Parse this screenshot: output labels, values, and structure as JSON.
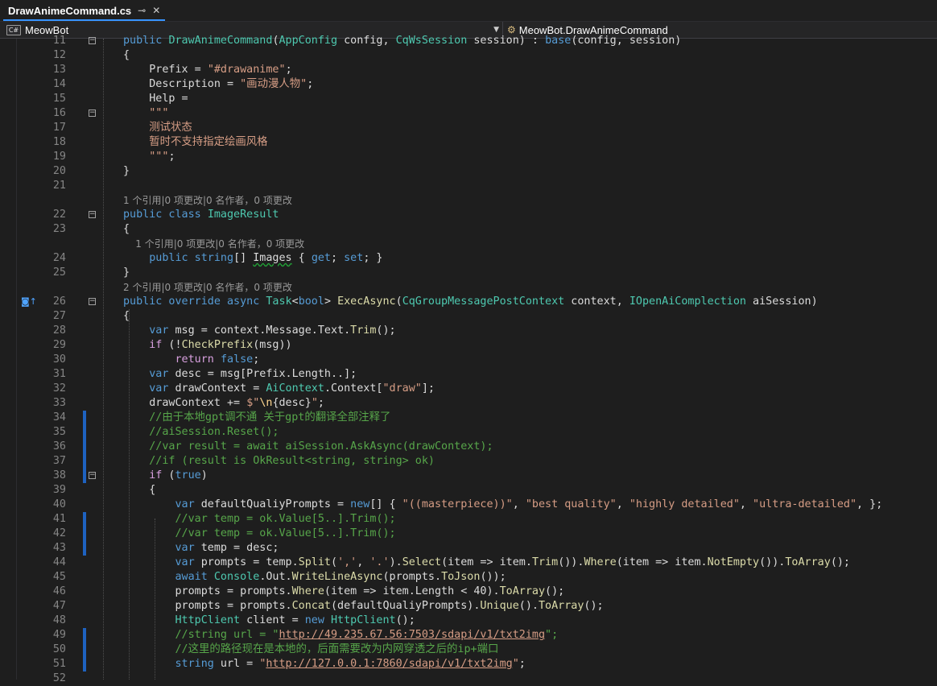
{
  "tab": {
    "title": "DrawAnimeCommand.cs",
    "pin_glyph": "⊸",
    "close_glyph": "✕"
  },
  "nav": {
    "project": "MeowBot",
    "project_icon": "C#",
    "member": "MeowBot.DrawAnimeCommand"
  },
  "editor": {
    "lines": [
      {
        "n": "11",
        "fold": "⊟",
        "toks": [
          [
            "kw",
            "public "
          ],
          [
            "ty",
            "DrawAnimeCommand"
          ],
          [
            "",
            "("
          ],
          [
            "ty",
            "AppConfig"
          ],
          [
            "",
            " config, "
          ],
          [
            "ty",
            "CqWsSession"
          ],
          [
            "",
            " session) : "
          ],
          [
            "kw",
            "base"
          ],
          [
            "",
            "(config, session)"
          ]
        ]
      },
      {
        "n": "12",
        "toks": [
          [
            "",
            "{"
          ]
        ]
      },
      {
        "n": "13",
        "toks": [
          [
            "",
            "    Prefix = "
          ],
          [
            "str",
            "\"#drawanime\""
          ],
          [
            "",
            ";"
          ]
        ]
      },
      {
        "n": "14",
        "toks": [
          [
            "",
            "    Description = "
          ],
          [
            "str",
            "\"画动漫人物\""
          ],
          [
            "",
            ";"
          ]
        ]
      },
      {
        "n": "15",
        "toks": [
          [
            "",
            "    Help ="
          ]
        ]
      },
      {
        "n": "16",
        "fold": "⊟",
        "toks": [
          [
            "str",
            "    \"\"\""
          ]
        ]
      },
      {
        "n": "17",
        "toks": [
          [
            "str",
            "    测试状态"
          ]
        ]
      },
      {
        "n": "18",
        "toks": [
          [
            "str",
            "    暂时不支持指定绘画风格"
          ]
        ]
      },
      {
        "n": "19",
        "toks": [
          [
            "str",
            "    \"\"\""
          ],
          [
            "",
            ";"
          ]
        ]
      },
      {
        "n": "20",
        "toks": [
          [
            "",
            "}"
          ]
        ]
      },
      {
        "n": "21",
        "toks": []
      },
      {
        "lens": "1 个引用|0 项更改|0 名作者，0 项更改"
      },
      {
        "n": "22",
        "fold": "⊟",
        "toks": [
          [
            "kw",
            "public class "
          ],
          [
            "ty",
            "ImageResult"
          ]
        ]
      },
      {
        "n": "23",
        "toks": [
          [
            "",
            "{"
          ]
        ]
      },
      {
        "lens": "    1 个引用|0 项更改|0 名作者，0 项更改"
      },
      {
        "n": "24",
        "toks": [
          [
            "kw",
            "    public string"
          ],
          [
            "",
            "[] "
          ],
          [
            "sq",
            "Images"
          ],
          [
            "",
            " { "
          ],
          [
            "kw",
            "get"
          ],
          [
            "",
            "; "
          ],
          [
            "kw",
            "set"
          ],
          [
            "",
            "; }"
          ]
        ]
      },
      {
        "n": "25",
        "toks": [
          [
            "",
            "}"
          ]
        ]
      },
      {
        "lens": "2 个引用|0 项更改|0 名作者，0 项更改"
      },
      {
        "n": "26",
        "fold": "⊟",
        "mark": "◙↑",
        "toks": [
          [
            "kw",
            "public override async "
          ],
          [
            "ty",
            "Task"
          ],
          [
            "",
            "<"
          ],
          [
            "kw",
            "bool"
          ],
          [
            "",
            "> "
          ],
          [
            "mth",
            "ExecAsync"
          ],
          [
            "",
            "("
          ],
          [
            "ty",
            "CqGroupMessagePostContext"
          ],
          [
            "",
            " context, "
          ],
          [
            "ty",
            "IOpenAiComplection"
          ],
          [
            "",
            " aiSession)"
          ]
        ]
      },
      {
        "n": "27",
        "toks": [
          [
            "",
            "{"
          ]
        ]
      },
      {
        "n": "28",
        "toks": [
          [
            "kw",
            "    var"
          ],
          [
            "",
            " msg = context.Message.Text."
          ],
          [
            "mth",
            "Trim"
          ],
          [
            "",
            "();"
          ]
        ]
      },
      {
        "n": "29",
        "toks": [
          [
            "ctl",
            "    if"
          ],
          [
            "",
            " (!"
          ],
          [
            "mth",
            "CheckPrefix"
          ],
          [
            "",
            "(msg))"
          ]
        ]
      },
      {
        "n": "30",
        "toks": [
          [
            "ctl",
            "        return "
          ],
          [
            "kw",
            "false"
          ],
          [
            "",
            ";"
          ]
        ]
      },
      {
        "n": "31",
        "toks": [
          [
            "kw",
            "    var"
          ],
          [
            "",
            " desc = msg[Prefix.Length..];"
          ]
        ]
      },
      {
        "n": "32",
        "toks": [
          [
            "kw",
            "    var"
          ],
          [
            "",
            " drawContext = "
          ],
          [
            "ty",
            "AiContext"
          ],
          [
            "",
            ".Context["
          ],
          [
            "str",
            "\"draw\""
          ],
          [
            "",
            "];"
          ]
        ]
      },
      {
        "n": "33",
        "toks": [
          [
            "",
            "    drawContext += "
          ],
          [
            "str",
            "$\""
          ],
          [
            "esc",
            "\\n"
          ],
          [
            "",
            "{desc}"
          ],
          [
            "str",
            "\""
          ],
          [
            "",
            ";"
          ]
        ]
      },
      {
        "n": "34",
        "chg": true,
        "toks": [
          [
            "com",
            "    //由于本地gpt调不通 关于gpt的翻译全部注释了"
          ]
        ]
      },
      {
        "n": "35",
        "chg": true,
        "toks": [
          [
            "com",
            "    //aiSession.Reset();"
          ]
        ]
      },
      {
        "n": "36",
        "chg": true,
        "toks": [
          [
            "com",
            "    //var result = await aiSession.AskAsync(drawContext);"
          ]
        ]
      },
      {
        "n": "37",
        "chg": true,
        "toks": [
          [
            "com",
            "    //if (result is OkResult<string, string> ok)"
          ]
        ]
      },
      {
        "n": "38",
        "chg": true,
        "fold": "⊟",
        "toks": [
          [
            "ctl",
            "    if"
          ],
          [
            "",
            " ("
          ],
          [
            "kw",
            "true"
          ],
          [
            "",
            ")"
          ]
        ]
      },
      {
        "n": "39",
        "toks": [
          [
            "",
            "    {"
          ]
        ]
      },
      {
        "n": "40",
        "toks": [
          [
            "kw",
            "        var"
          ],
          [
            "",
            " defaultQualiyPrompts = "
          ],
          [
            "kw",
            "new"
          ],
          [
            "",
            "[] { "
          ],
          [
            "str",
            "\"((masterpiece))\""
          ],
          [
            "",
            ", "
          ],
          [
            "str",
            "\"best quality\""
          ],
          [
            "",
            ", "
          ],
          [
            "str",
            "\"highly detailed\""
          ],
          [
            "",
            ", "
          ],
          [
            "str",
            "\"ultra-detailed\""
          ],
          [
            "",
            ", };"
          ]
        ]
      },
      {
        "n": "41",
        "chg": true,
        "toks": [
          [
            "com",
            "        //var temp = ok.Value[5..].Trim();"
          ]
        ]
      },
      {
        "n": "42",
        "chg": true,
        "toks": [
          [
            "com",
            "        //var temp = ok.Value[5..].Trim();"
          ]
        ]
      },
      {
        "n": "43",
        "chg": true,
        "toks": [
          [
            "kw",
            "        var"
          ],
          [
            "",
            " temp = desc;"
          ]
        ]
      },
      {
        "n": "44",
        "toks": [
          [
            "kw",
            "        var"
          ],
          [
            "",
            " prompts = temp."
          ],
          [
            "mth",
            "Split"
          ],
          [
            "",
            "("
          ],
          [
            "str",
            "','"
          ],
          [
            "",
            ", "
          ],
          [
            "str",
            "'.'"
          ],
          [
            "",
            ")."
          ],
          [
            "mth",
            "Select"
          ],
          [
            "",
            "(item => item."
          ],
          [
            "mth",
            "Trim"
          ],
          [
            "",
            "())."
          ],
          [
            "mth",
            "Where"
          ],
          [
            "",
            "(item => item."
          ],
          [
            "mth",
            "NotEmpty"
          ],
          [
            "",
            "())."
          ],
          [
            "mth",
            "ToArray"
          ],
          [
            "",
            "();"
          ]
        ]
      },
      {
        "n": "45",
        "toks": [
          [
            "kw",
            "        await "
          ],
          [
            "ty",
            "Console"
          ],
          [
            "",
            ".Out."
          ],
          [
            "mth",
            "WriteLineAsync"
          ],
          [
            "",
            "(prompts."
          ],
          [
            "mth",
            "ToJson"
          ],
          [
            "",
            "());"
          ]
        ]
      },
      {
        "n": "46",
        "toks": [
          [
            "",
            "        prompts = prompts."
          ],
          [
            "mth",
            "Where"
          ],
          [
            "",
            "(item => item.Length < 40)."
          ],
          [
            "mth",
            "ToArray"
          ],
          [
            "",
            "();"
          ]
        ]
      },
      {
        "n": "47",
        "toks": [
          [
            "",
            "        prompts = prompts."
          ],
          [
            "mth",
            "Concat"
          ],
          [
            "",
            "(defaultQualiyPrompts)."
          ],
          [
            "mth",
            "Unique"
          ],
          [
            "",
            "()."
          ],
          [
            "mth",
            "ToArray"
          ],
          [
            "",
            "();"
          ]
        ]
      },
      {
        "n": "48",
        "toks": [
          [
            "ty",
            "        HttpClient"
          ],
          [
            "",
            " client = "
          ],
          [
            "kw",
            "new "
          ],
          [
            "ty",
            "HttpClient"
          ],
          [
            "",
            "();"
          ]
        ]
      },
      {
        "n": "49",
        "chg": true,
        "toks": [
          [
            "com",
            "        //string url = \""
          ],
          [
            "clink",
            "http://49.235.67.56:7503/sdapi/v1/txt2img"
          ],
          [
            "com",
            "\";"
          ]
        ]
      },
      {
        "n": "50",
        "chg": true,
        "toks": [
          [
            "com",
            "        //这里的路径现在是本地的，后面需要改为内网穿透之后的ip+端口"
          ]
        ]
      },
      {
        "n": "51",
        "chg": true,
        "toks": [
          [
            "kw",
            "        string"
          ],
          [
            "",
            " url = "
          ],
          [
            "str",
            "\""
          ],
          [
            "link",
            "http://127.0.0.1:7860/sdapi/v1/txt2img"
          ],
          [
            "str",
            "\""
          ],
          [
            "",
            ";"
          ]
        ]
      },
      {
        "n": "52",
        "toks": []
      }
    ]
  }
}
